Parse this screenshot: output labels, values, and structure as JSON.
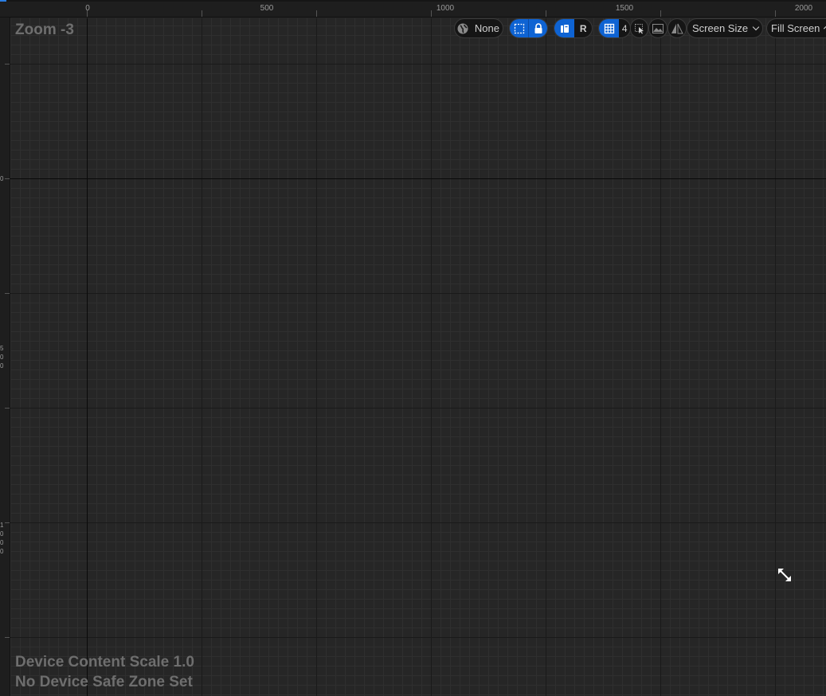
{
  "rulers": {
    "top_labels": [
      "0",
      "500",
      "1000",
      "1500",
      "2000"
    ],
    "left_label_groups": [
      [
        "0"
      ],
      [
        "5",
        "0",
        "0"
      ],
      [
        "1",
        "0",
        "0",
        "0"
      ]
    ]
  },
  "canvas": {
    "zoom_label": "Zoom -3",
    "device_content_scale": "Device Content Scale 1.0",
    "safe_zone_status": "No Device Safe Zone Set"
  },
  "toolbar": {
    "world_value": "None",
    "respect_locks_key": "R",
    "grid_snap_value": "4",
    "screen_size_label": "Screen Size",
    "fill_screen_label": "Fill Screen"
  },
  "icons": {
    "world": "globe-icon",
    "marquee": "marquee-select-icon",
    "lock": "lock-icon",
    "transform": "transform-icon",
    "grid": "grid-icon",
    "select": "select-cursor-icon",
    "background": "background-image-icon",
    "flip": "flip-icon",
    "resize": "resize-arrows-icon"
  },
  "colors": {
    "accent": "#0e63d3",
    "background": "#262626"
  }
}
